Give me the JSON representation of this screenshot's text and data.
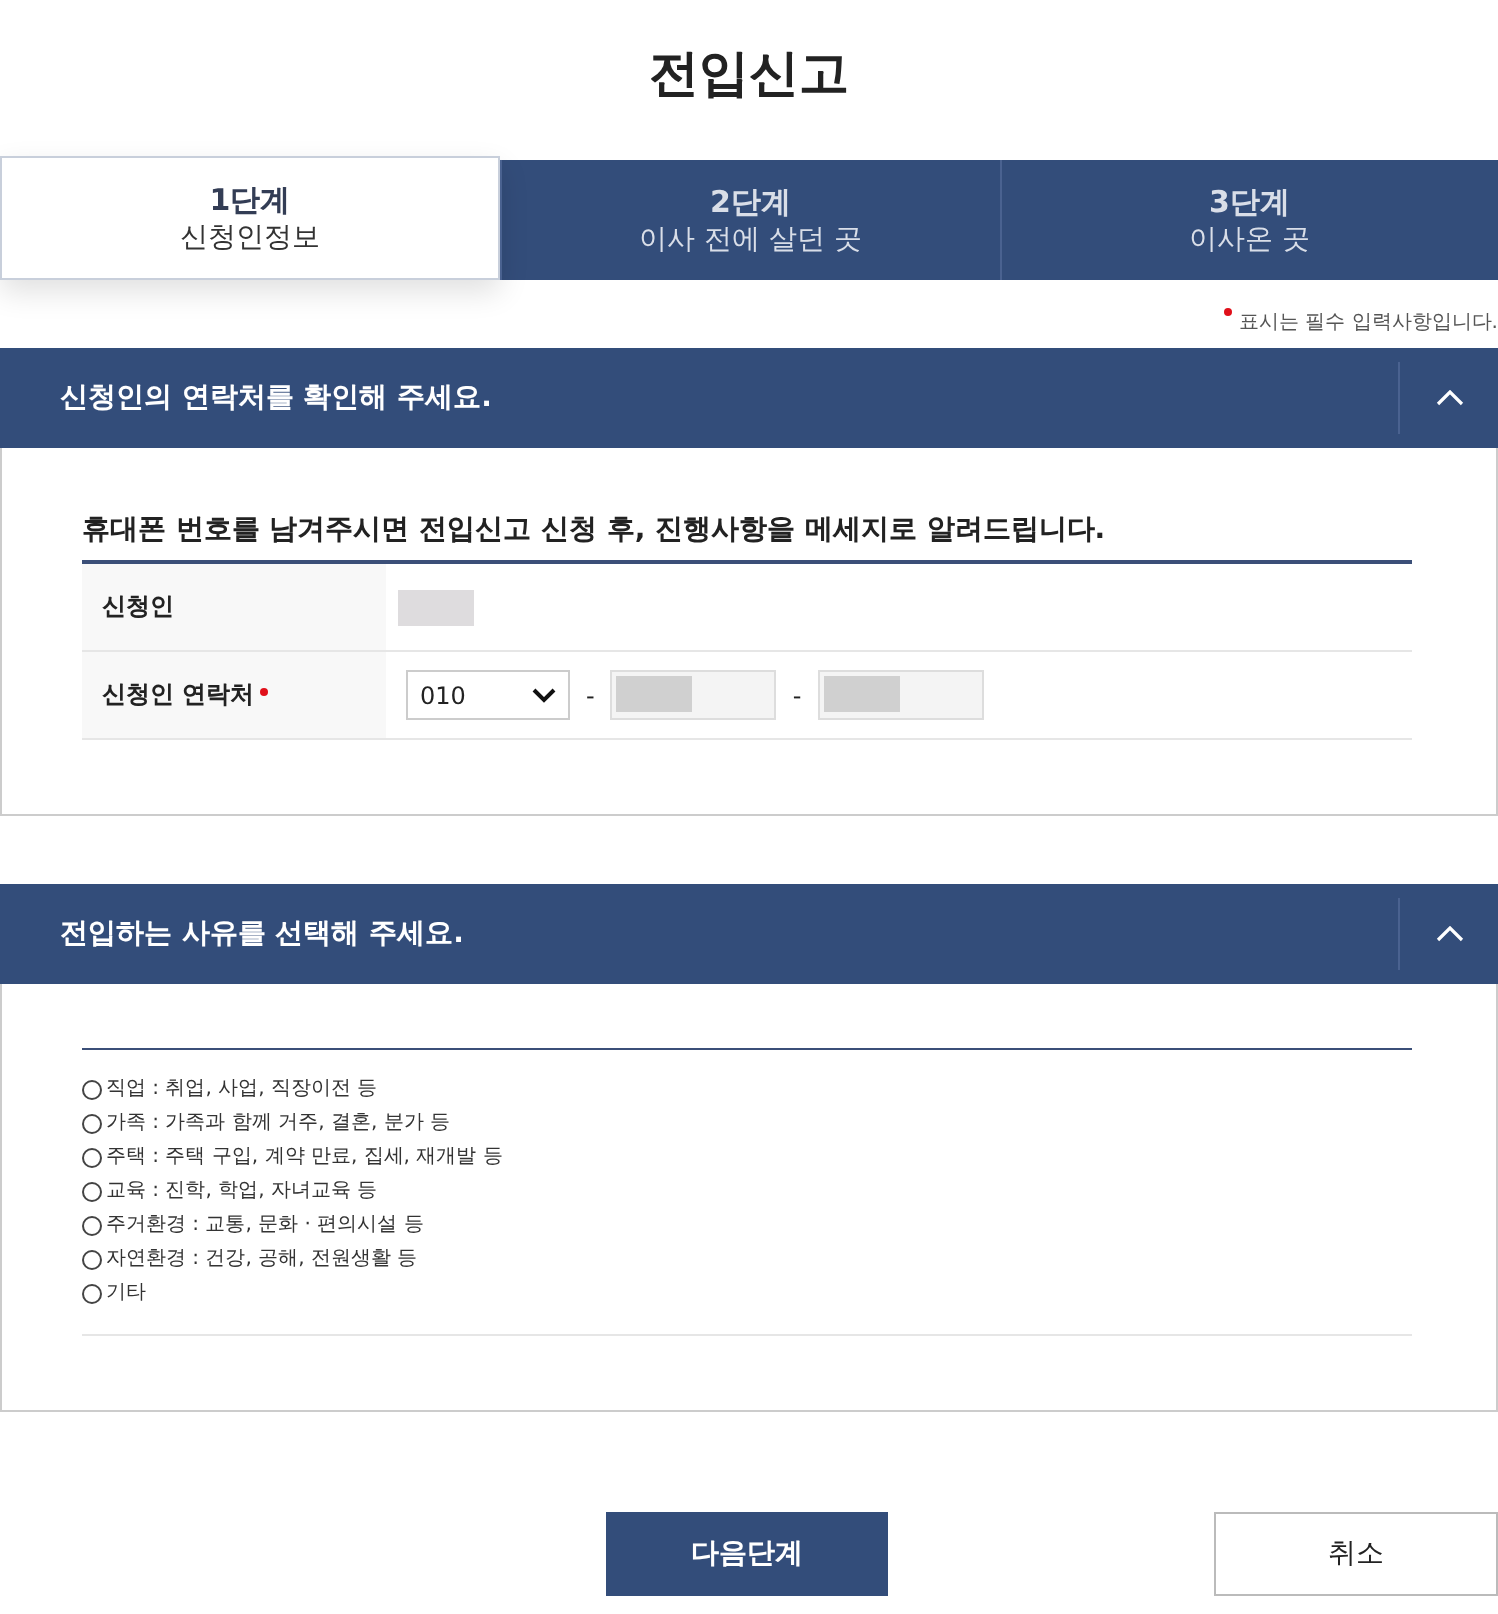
{
  "page_title": "전입신고",
  "steps": [
    {
      "number": "1단계",
      "label": "신청인정보",
      "selected": true
    },
    {
      "number": "2단계",
      "label": "이사 전에 살던 곳",
      "selected": false
    },
    {
      "number": "3단계",
      "label": "이사온 곳",
      "selected": false
    }
  ],
  "required_note": "표시는 필수 입력사항입니다.",
  "contact_section": {
    "title": "신청인의 연락처를 확인해 주세요.",
    "expanded": true,
    "intro": "휴대폰 번호를 남겨주시면 전입신고 신청 후, 진행사항을 메세지로 알려드립니다.",
    "rows": [
      {
        "label": "신청인",
        "required": false,
        "kind": "masked"
      },
      {
        "label": "신청인 연락처",
        "required": true,
        "kind": "phone",
        "prefix": "010",
        "separator": "-"
      }
    ]
  },
  "reason_section": {
    "title": "전입하는 사유를 선택해 주세요.",
    "expanded": true,
    "options": [
      {
        "label": "직업 : 취업, 사업, 직장이전 등",
        "selected": false
      },
      {
        "label": "가족 : 가족과 함께 거주, 결혼, 분가 등",
        "selected": false
      },
      {
        "label": "주택 : 주택 구입, 계약 만료, 집세, 재개발 등",
        "selected": false
      },
      {
        "label": "교육 : 진학, 학업, 자녀교육 등",
        "selected": false
      },
      {
        "label": "주거환경 : 교통, 문화 · 편의시설 등",
        "selected": false
      },
      {
        "label": "자연환경 : 건강, 공해, 전원생활 등",
        "selected": false
      },
      {
        "label": "기타",
        "selected": false
      }
    ]
  },
  "buttons": {
    "next": "다음단계",
    "cancel": "취소"
  }
}
